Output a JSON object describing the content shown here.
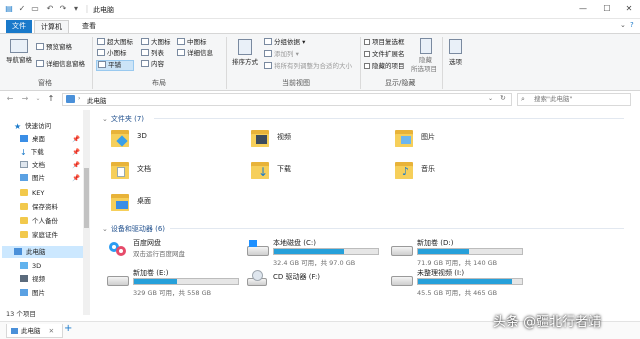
{
  "window": {
    "title": "此电脑",
    "controls": [
      "minimize",
      "maximize",
      "close"
    ]
  },
  "ribbon_tabs": {
    "file": "文件",
    "computer": "计算机",
    "view": "查看"
  },
  "ribbon": {
    "panes": {
      "nav_pane": "导航窗格",
      "preview_pane": "预览窗格",
      "details_pane": "详细信息窗格",
      "label": "窗格"
    },
    "layout": {
      "xl_icons": "超大图标",
      "large_icons": "大图标",
      "medium_icons": "中图标",
      "small_icons": "小图标",
      "list": "列表",
      "details": "详细信息",
      "tiles": "平铺",
      "content": "内容",
      "label": "布局"
    },
    "current_view": {
      "sort_by": "排序方式",
      "group_by": "分组依据",
      "add_columns": "添加列",
      "size_columns": "将所有列调整为合适的大小",
      "label": "当前视图"
    },
    "show_hide": {
      "item_checkboxes": "项目复选框",
      "file_extensions": "文件扩展名",
      "hidden_items": "隐藏的项目",
      "hide_selected_1": "隐藏",
      "hide_selected_2": "所选项目",
      "label": "显示/隐藏"
    },
    "options": "选项"
  },
  "address": {
    "path": "此电脑",
    "search_placeholder": "搜索\"此电脑\""
  },
  "nav_pane": {
    "items": [
      {
        "label": "快速访问",
        "icon": "star-icon"
      },
      {
        "label": "桌面",
        "icon": "desktop-icon",
        "pinned": true
      },
      {
        "label": "下载",
        "icon": "download-icon",
        "pinned": true
      },
      {
        "label": "文档",
        "icon": "document-icon",
        "pinned": true
      },
      {
        "label": "图片",
        "icon": "picture-icon",
        "pinned": true
      },
      {
        "label": "KEY",
        "icon": "folder-icon"
      },
      {
        "label": "保存资料",
        "icon": "folder-icon"
      },
      {
        "label": "个人备份",
        "icon": "folder-icon"
      },
      {
        "label": "家庭证件",
        "icon": "folder-icon"
      },
      {
        "label": "此电脑",
        "icon": "computer-icon"
      },
      {
        "label": "3D",
        "icon": "3d-objects-icon"
      },
      {
        "label": "视频",
        "icon": "video-icon"
      },
      {
        "label": "图片",
        "icon": "picture-icon"
      }
    ]
  },
  "content": {
    "folders_header": "文件夹 (7)",
    "folders": [
      {
        "name": "3D",
        "icon": "3d-objects-folder-icon"
      },
      {
        "name": "视频",
        "icon": "video-folder-icon"
      },
      {
        "name": "图片",
        "icon": "picture-folder-icon"
      },
      {
        "name": "文档",
        "icon": "document-folder-icon"
      },
      {
        "name": "下载",
        "icon": "download-folder-icon"
      },
      {
        "name": "音乐",
        "icon": "music-folder-icon"
      },
      {
        "name": "桌面",
        "icon": "desktop-folder-icon"
      }
    ],
    "devices_header": "设备和驱动器 (6)",
    "devices": [
      {
        "name": "百度网盘",
        "sub": "双击运行百度网盘",
        "icon": "baidu-netdisk-icon"
      },
      {
        "name": "本地磁盘 (C:)",
        "size": "32.4 GB 可用，共 97.0 GB",
        "used_fraction": 0.67,
        "icon": "windows-drive-icon"
      },
      {
        "name": "新加卷 (D:)",
        "size": "71.9 GB 可用，共 140 GB",
        "used_fraction": 0.49,
        "icon": "hard-drive-icon"
      },
      {
        "name": "新加卷 (E:)",
        "size": "329 GB 可用，共 558 GB",
        "used_fraction": 0.41,
        "icon": "hard-drive-icon"
      },
      {
        "name": "CD 驱动器 (F:)",
        "icon": "cd-drive-icon"
      },
      {
        "name": "未整理视频 (I:)",
        "size": "45.5 GB 可用，共 465 GB",
        "used_fraction": 0.9,
        "icon": "hard-drive-icon"
      }
    ]
  },
  "status": {
    "count": "13 个项目",
    "taskbar_tab": "此电脑",
    "add_tab": "+"
  },
  "watermark": "头条 @疆北行者靖",
  "colors": {
    "accent": "#1979ca",
    "bar_fill": "#26a0da",
    "folder": "#f6cf5a"
  }
}
